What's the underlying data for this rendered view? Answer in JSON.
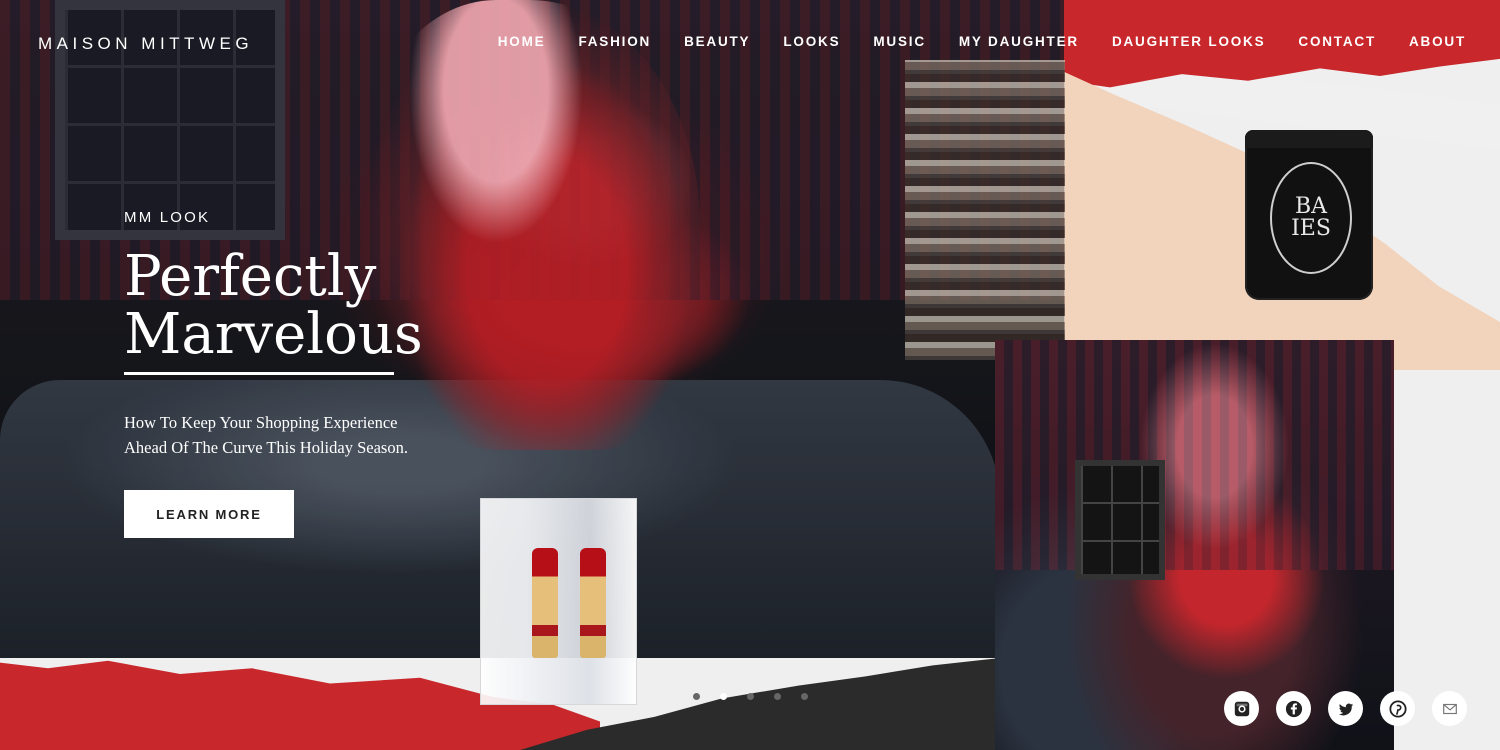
{
  "site": {
    "logo": "MAISON MITTWEG"
  },
  "nav": {
    "items": [
      {
        "label": "HOME"
      },
      {
        "label": "FASHION"
      },
      {
        "label": "BEAUTY"
      },
      {
        "label": "LOOKS"
      },
      {
        "label": "MUSIC"
      },
      {
        "label": "MY DAUGHTER"
      },
      {
        "label": "DAUGHTER LOOKS"
      },
      {
        "label": "CONTACT"
      },
      {
        "label": "ABOUT"
      }
    ]
  },
  "hero": {
    "kicker": "MM LOOK",
    "headline_line1": "Perfectly",
    "headline_line2": "Marvelous",
    "subline_line1": "How To Keep Your Shopping Experience",
    "subline_line2": "Ahead Of The Curve This Holiday Season.",
    "cta_label": "LEARN MORE"
  },
  "carousel": {
    "slide_count": 5,
    "active_index": 1
  },
  "candle_label": {
    "line1": "BA",
    "line2": "IES"
  },
  "social": {
    "items": [
      {
        "name": "instagram-icon"
      },
      {
        "name": "facebook-icon"
      },
      {
        "name": "twitter-icon"
      },
      {
        "name": "pinterest-icon"
      },
      {
        "name": "email-icon"
      }
    ]
  },
  "colors": {
    "accent_red": "#c8282c",
    "peach": "#f2d4bd",
    "dark": "#2b2b2b"
  }
}
